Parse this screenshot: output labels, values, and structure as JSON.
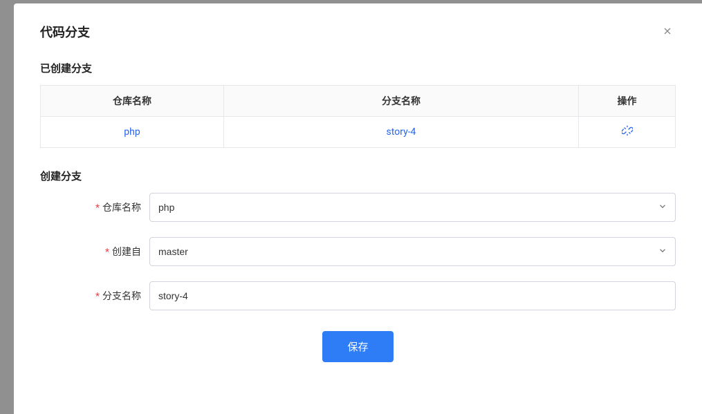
{
  "modal": {
    "title": "代码分支",
    "section_existing": "已创建分支",
    "section_create": "创建分支"
  },
  "table": {
    "headers": {
      "repo": "仓库名称",
      "branch": "分支名称",
      "action": "操作"
    },
    "row": {
      "repo": "php",
      "branch": "story-4"
    }
  },
  "form": {
    "labels": {
      "repo": "仓库名称",
      "from": "创建自",
      "branch": "分支名称"
    },
    "values": {
      "repo": "php",
      "from": "master",
      "branch": "story-4"
    },
    "save": "保存"
  }
}
